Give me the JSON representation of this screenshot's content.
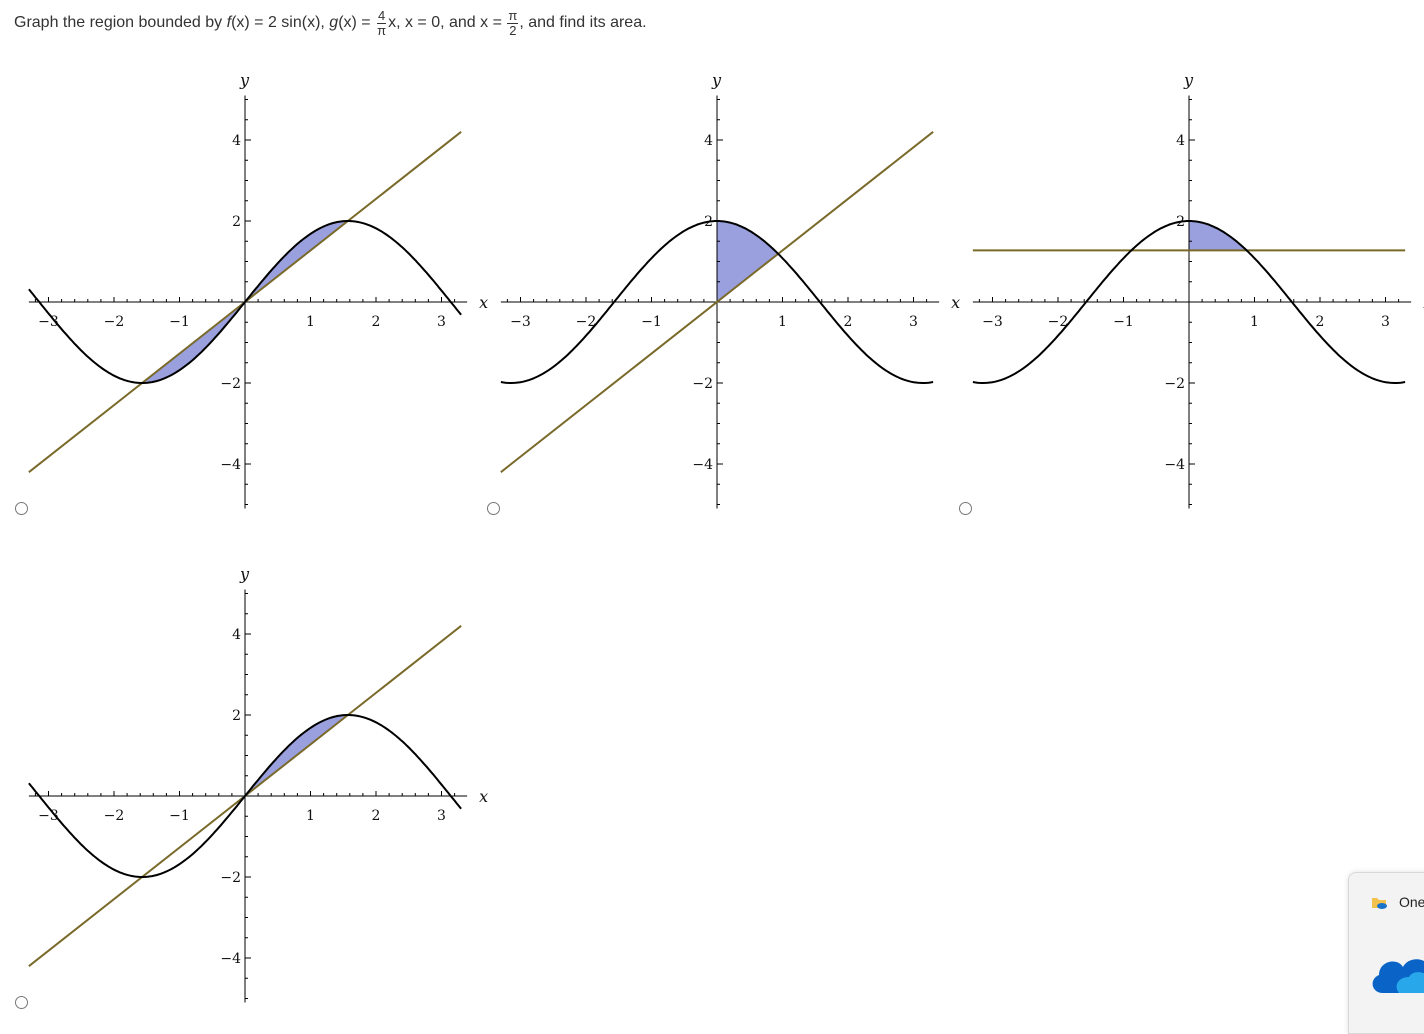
{
  "question": {
    "prefix": "Graph the region bounded by ",
    "f_name": "f",
    "f_def": "(x) = 2 sin(x), ",
    "g_name": "g",
    "g_def": "(x) = ",
    "g_num": "4",
    "g_den": "π",
    "g_rest": "x, x = 0, and x = ",
    "x_num": "π",
    "x_den": "2",
    "suffix": ", and find its area."
  },
  "axis_labels": {
    "x": "x",
    "y": "y"
  },
  "colors": {
    "sine": "#000000",
    "line": "#7a6a2a",
    "fill": "#9aa0de",
    "axis": "#000000"
  },
  "options": [
    {
      "id": "option-a",
      "selected": false
    },
    {
      "id": "option-b",
      "selected": false
    },
    {
      "id": "option-c",
      "selected": false
    },
    {
      "id": "option-d",
      "selected": false
    }
  ],
  "chart_data": [
    {
      "type": "line",
      "xlim": [
        -3.3,
        3.3
      ],
      "ylim": [
        -5.1,
        5.1
      ],
      "x_ticks": [
        -3,
        -2,
        -1,
        1,
        2,
        3
      ],
      "y_ticks": [
        4,
        2,
        -2,
        -4
      ],
      "series": [
        {
          "function": "2 sin(x)",
          "domain": [
            -3.3,
            3.3
          ]
        },
        {
          "function": "(4/π) x",
          "domain": [
            -3.3,
            3.3
          ]
        }
      ],
      "shaded_regions": [
        [
          -1.5708,
          0
        ],
        [
          0,
          1.5708
        ]
      ]
    },
    {
      "type": "line",
      "xlim": [
        -3.3,
        3.3
      ],
      "ylim": [
        -5.1,
        5.1
      ],
      "x_ticks": [
        -3,
        -2,
        -1,
        1,
        2,
        3
      ],
      "y_ticks": [
        4,
        2,
        -2,
        -4
      ],
      "series": [
        {
          "function": "2 cos(x)",
          "domain": [
            -3.3,
            3.3
          ]
        },
        {
          "function": "(4/π) x",
          "domain": [
            -3.3,
            3.3
          ]
        }
      ],
      "shaded_regions": [
        [
          0,
          0.94
        ]
      ]
    },
    {
      "type": "line",
      "xlim": [
        -3.3,
        3.3
      ],
      "ylim": [
        -5.1,
        5.1
      ],
      "x_ticks": [
        -3,
        -2,
        -1,
        1,
        2,
        3
      ],
      "y_ticks": [
        4,
        2,
        -2,
        -4
      ],
      "series": [
        {
          "function": "2 cos(x)",
          "domain": [
            -3.3,
            3.3
          ]
        },
        {
          "function": "4/π",
          "domain": [
            -3.3,
            3.3
          ]
        }
      ],
      "shaded_regions": [
        [
          0,
          0.88
        ]
      ]
    },
    {
      "type": "line",
      "xlim": [
        -3.3,
        3.3
      ],
      "ylim": [
        -5.1,
        5.1
      ],
      "x_ticks": [
        -3,
        -2,
        -1,
        1,
        2,
        3
      ],
      "y_ticks": [
        4,
        2,
        -2,
        -4
      ],
      "series": [
        {
          "function": "2 sin(x)",
          "domain": [
            -3.3,
            3.3
          ]
        },
        {
          "function": "(4/π) x",
          "domain": [
            -3.3,
            3.3
          ]
        }
      ],
      "shaded_regions": [
        [
          0,
          1.5708
        ]
      ]
    }
  ],
  "popup": {
    "title": "One"
  }
}
